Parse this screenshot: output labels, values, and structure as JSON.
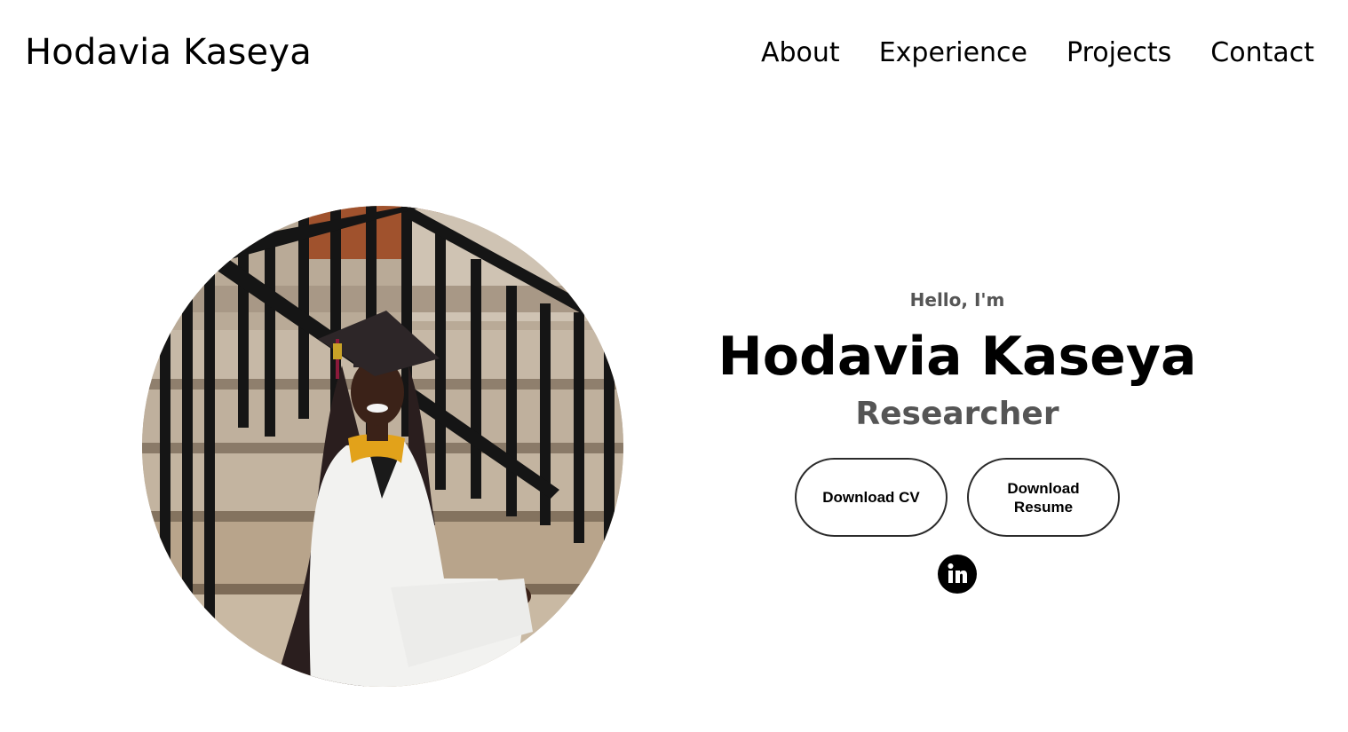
{
  "header": {
    "logo_text": "Hodavia Kaseya",
    "nav": [
      {
        "label": "About"
      },
      {
        "label": "Experience"
      },
      {
        "label": "Projects"
      },
      {
        "label": "Contact"
      }
    ]
  },
  "hero": {
    "greeting": "Hello, I'm",
    "name": "Hodavia Kaseya",
    "role": "Researcher",
    "buttons": {
      "cv_label": "Download CV",
      "resume_label": "Download Resume"
    },
    "social": [
      {
        "icon": "linkedin-icon"
      }
    ],
    "profile_image": {
      "icon": "profile-photo"
    }
  },
  "colors": {
    "text": "#000000",
    "muted_text": "#555555",
    "button_border": "#2b2b2b",
    "background": "#ffffff"
  }
}
